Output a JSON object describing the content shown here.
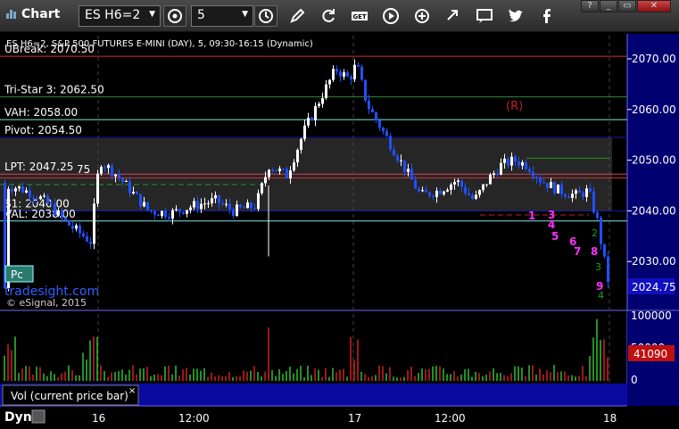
{
  "toolbar": {
    "app_title": "Chart",
    "symbol": "ES H6=2",
    "interval": "5",
    "icons": [
      "settings-icon",
      "clock-icon",
      "pencil-icon",
      "refresh-icon",
      "get-icon",
      "play-icon",
      "compare-icon",
      "chat-icon",
      "twitter-icon",
      "facebook-icon"
    ],
    "window_buttons": [
      "?",
      "_",
      "▭",
      "✕"
    ]
  },
  "chart": {
    "header": "ES H6=2, S&P 500 FUTURES E-MINI (DAY), 5, 09:30-16:15 (Dynamic)",
    "levels": [
      {
        "label": "UBreak: 2070.50",
        "value": 2070.5,
        "color": "#c83030"
      },
      {
        "label": "Tri-Star 3: 2062.50",
        "value": 2062.5,
        "color": "#2e8b2e"
      },
      {
        "label": "VAH: 2058.00",
        "value": 2058.0,
        "color": "#7fe3e3"
      },
      {
        "label": "Pivot: 2054.50",
        "value": 2054.5,
        "color": "#1a1aa8"
      },
      {
        "label": "LPT: 2047.25",
        "value": 2047.25,
        "color": "#d04060"
      },
      {
        "label": "S1: 2040.00",
        "value": 2040.0,
        "color": "#1a1aa8"
      },
      {
        "label": "VAL: 2038.00",
        "value": 2038.0,
        "color": "#7fe3e3"
      }
    ],
    "lpt_extra": "75",
    "r_marker": "(R)",
    "price_axis": [
      "2070.00",
      "2060.00",
      "2050.00",
      "2040.00",
      "2030.00"
    ],
    "last_price": "2024.75",
    "pc_button": "Pc",
    "watermark": "tradesight.com",
    "copyright": "© eSignal, 2015",
    "td_counts_magenta": [
      "1",
      "3",
      "4",
      "5",
      "6",
      "7",
      "8",
      "9"
    ],
    "td_counts_green": [
      "2",
      "3",
      "4"
    ]
  },
  "volume": {
    "axis": [
      "100000",
      "50000",
      "0"
    ],
    "last_value": "41090",
    "study_label": "Vol (current price bar)",
    "close": "×"
  },
  "time_axis": {
    "mode": "Dyn",
    "labels": [
      "16",
      "12:00",
      "17",
      "12:00",
      "18"
    ]
  },
  "colors": {
    "accent": "#0a0aa0",
    "axis_bg": "#000070",
    "up": "#ffffff",
    "down": "#1e50ff"
  }
}
